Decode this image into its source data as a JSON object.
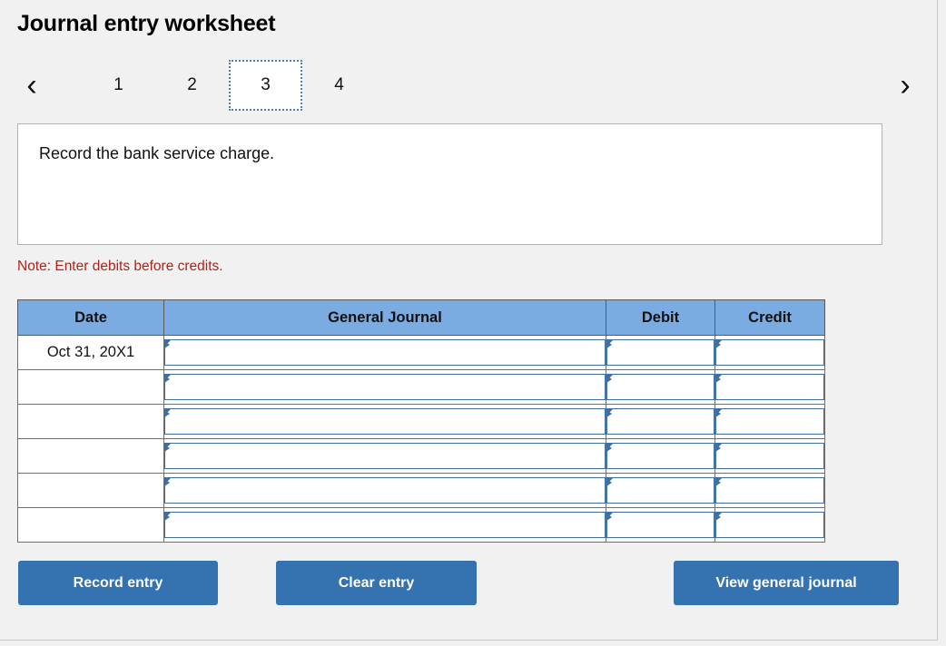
{
  "page": {
    "title": "Journal entry worksheet"
  },
  "pager": {
    "prev_icon": "chevron-left-icon",
    "next_icon": "chevron-right-icon",
    "prev_label": "‹",
    "next_label": "›",
    "pages": [
      {
        "label": "1",
        "selected": false
      },
      {
        "label": "2",
        "selected": false
      },
      {
        "label": "3",
        "selected": true
      },
      {
        "label": "4",
        "selected": false
      }
    ],
    "selected_page": "3"
  },
  "instruction": {
    "text": "Record the bank service charge."
  },
  "note": {
    "text": "Note: Enter debits before credits.",
    "color": "#b02318"
  },
  "table": {
    "headers": {
      "date": "Date",
      "general_journal": "General Journal",
      "debit": "Debit",
      "credit": "Credit"
    },
    "header_bg": "#7aace2",
    "rows": [
      {
        "date": "Oct 31, 20X1",
        "general_journal": "",
        "debit": "",
        "credit": ""
      },
      {
        "date": "",
        "general_journal": "",
        "debit": "",
        "credit": ""
      },
      {
        "date": "",
        "general_journal": "",
        "debit": "",
        "credit": ""
      },
      {
        "date": "",
        "general_journal": "",
        "debit": "",
        "credit": ""
      },
      {
        "date": "",
        "general_journal": "",
        "debit": "",
        "credit": ""
      },
      {
        "date": "",
        "general_journal": "",
        "debit": "",
        "credit": ""
      }
    ]
  },
  "buttons": {
    "record": "Record entry",
    "clear": "Clear entry",
    "view": "View general journal",
    "color": "#3572b0"
  }
}
